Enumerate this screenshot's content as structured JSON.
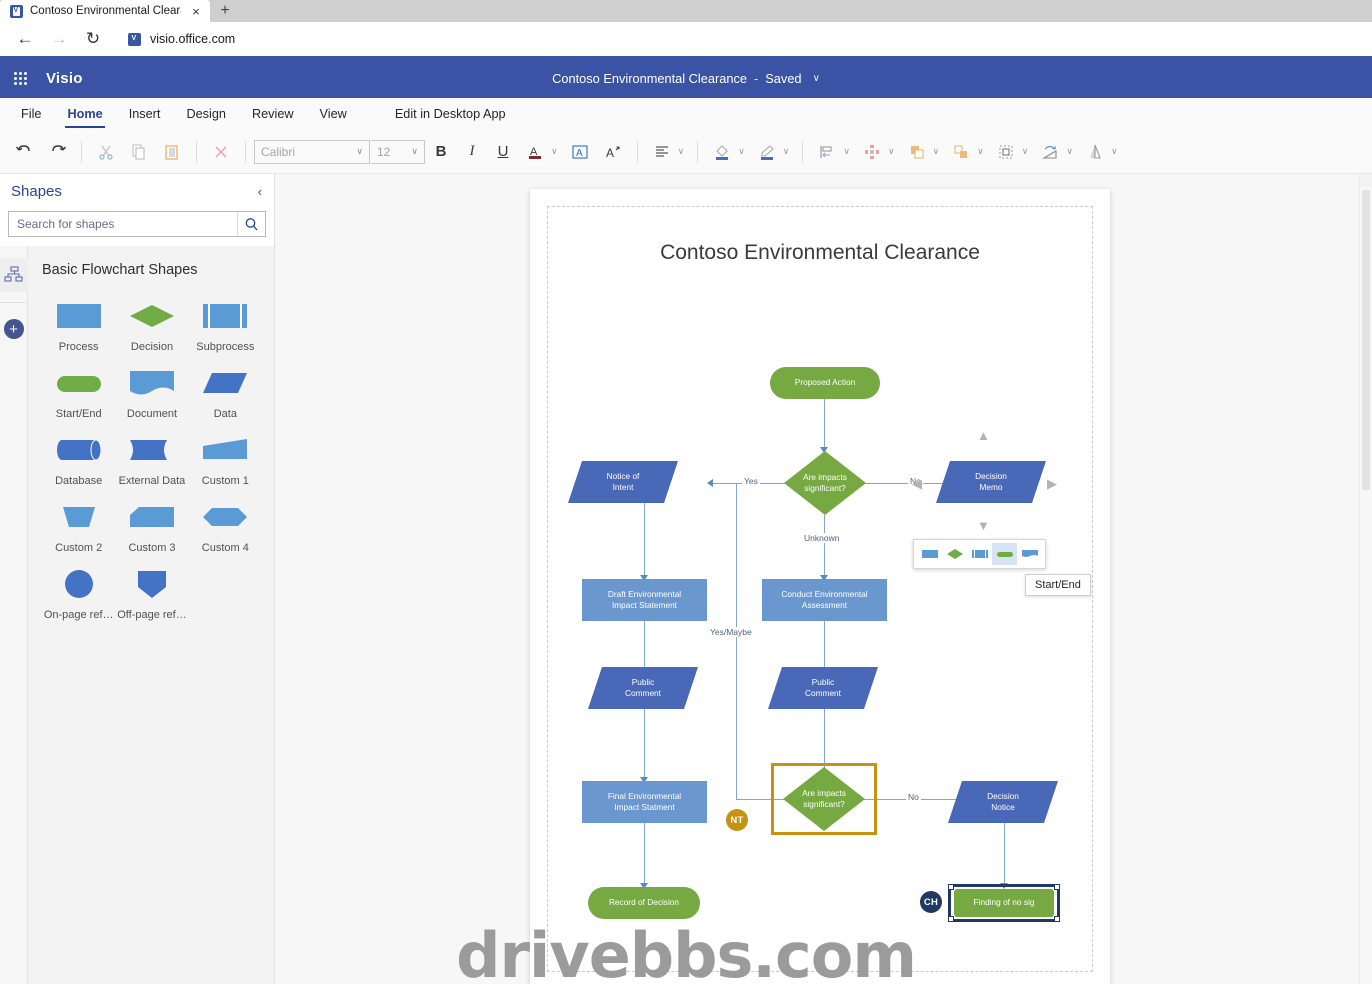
{
  "browser": {
    "tab_title": "Contoso Environmental Clearanc",
    "tab_close": "×",
    "new_tab": "+",
    "back": "←",
    "forward": "→",
    "reload": "↻",
    "url": "visio.office.com"
  },
  "app": {
    "name": "Visio",
    "doc_title": "Contoso Environmental Clearance",
    "separator": "-",
    "save_state": "Saved",
    "title_chevron": "∨"
  },
  "ribbon": {
    "tabs": [
      {
        "label": "File",
        "active": false
      },
      {
        "label": "Home",
        "active": true
      },
      {
        "label": "Insert",
        "active": false
      },
      {
        "label": "Design",
        "active": false
      },
      {
        "label": "Review",
        "active": false
      },
      {
        "label": "View",
        "active": false
      }
    ],
    "desktop_link": "Edit in Desktop App",
    "font_name": "Calibri",
    "font_size": "12",
    "bold": "B",
    "italic": "I",
    "underline": "U",
    "caret": "∨"
  },
  "shapes_panel": {
    "title": "Shapes",
    "collapse_icon": "‹",
    "search_placeholder": "Search for shapes",
    "search_value": "",
    "stencil_title": "Basic Flowchart Shapes",
    "items": [
      {
        "label": "Process",
        "kind": "rect",
        "color": "#5b9bd5"
      },
      {
        "label": "Decision",
        "kind": "diamond",
        "color": "#70ad47"
      },
      {
        "label": "Subprocess",
        "kind": "subprocess",
        "color": "#5b9bd5"
      },
      {
        "label": "Start/End",
        "kind": "terminator",
        "color": "#70ad47"
      },
      {
        "label": "Document",
        "kind": "document",
        "color": "#5b9bd5"
      },
      {
        "label": "Data",
        "kind": "parallelogram",
        "color": "#4472c4"
      },
      {
        "label": "Database",
        "kind": "cylinder",
        "color": "#4472c4"
      },
      {
        "label": "External Data",
        "kind": "extdata",
        "color": "#4472c4"
      },
      {
        "label": "Custom 1",
        "kind": "custom1",
        "color": "#5b9bd5"
      },
      {
        "label": "Custom 2",
        "kind": "custom2",
        "color": "#5b9bd5"
      },
      {
        "label": "Custom 3",
        "kind": "custom3",
        "color": "#5b9bd5"
      },
      {
        "label": "Custom 4",
        "kind": "custom4",
        "color": "#5b9bd5"
      },
      {
        "label": "On-page ref…",
        "kind": "circle",
        "color": "#4472c4"
      },
      {
        "label": "Off-page ref…",
        "kind": "offpage",
        "color": "#4472c4"
      }
    ]
  },
  "diagram": {
    "title": "Contoso Environmental Clearance",
    "nodes": [
      {
        "id": "proposed",
        "label": "Proposed Action",
        "type": "terminator"
      },
      {
        "id": "decision1",
        "label": "Are impacts\nsignificant?",
        "type": "decision"
      },
      {
        "id": "notice",
        "label": "Notice of\nIntent",
        "type": "data"
      },
      {
        "id": "memo",
        "label": "Decision\nMemo",
        "type": "data"
      },
      {
        "id": "draft",
        "label": "Draft Environmental\nImpact Statement",
        "type": "process"
      },
      {
        "id": "conduct",
        "label": "Conduct Environmental\nAssessment",
        "type": "process"
      },
      {
        "id": "public1",
        "label": "Public\nComment",
        "type": "data"
      },
      {
        "id": "public2",
        "label": "Public\nComment",
        "type": "data"
      },
      {
        "id": "final",
        "label": "Final Environmental\nImpact Statment",
        "type": "process"
      },
      {
        "id": "decision2",
        "label": "Are impacts\nsignificant?",
        "type": "decision",
        "selected": "gold"
      },
      {
        "id": "notice2",
        "label": "Decision\nNotice",
        "type": "data"
      },
      {
        "id": "record",
        "label": "Record of Decision",
        "type": "terminator"
      },
      {
        "id": "finding",
        "label": "Finding of no sig",
        "type": "terminator",
        "selected": "navy"
      }
    ],
    "edge_labels": [
      "Yes",
      "No",
      "Unknown",
      "Yes/Maybe",
      "No"
    ],
    "labels": {
      "yes": "Yes",
      "no_top": "No",
      "unknown": "Unknown",
      "yes_maybe": "Yes/Maybe",
      "no_bottom": "No"
    },
    "avatars": [
      {
        "initials": "NT",
        "color": "#c69214"
      },
      {
        "initials": "CH",
        "color": "#1f3864"
      }
    ],
    "mini_toolbar": {
      "tooltip": "Start/End",
      "items": [
        "Process",
        "Decision",
        "Subprocess",
        "Start/End",
        "Document"
      ],
      "selected_index": 3
    }
  },
  "colors": {
    "brand": "#3b53a4",
    "accent_green": "#76a941",
    "accent_blue": "#4472c4",
    "process_blue": "#6a97ce",
    "gold": "#c69214",
    "navy": "#1f3864"
  },
  "watermark": "drivebbs.com"
}
